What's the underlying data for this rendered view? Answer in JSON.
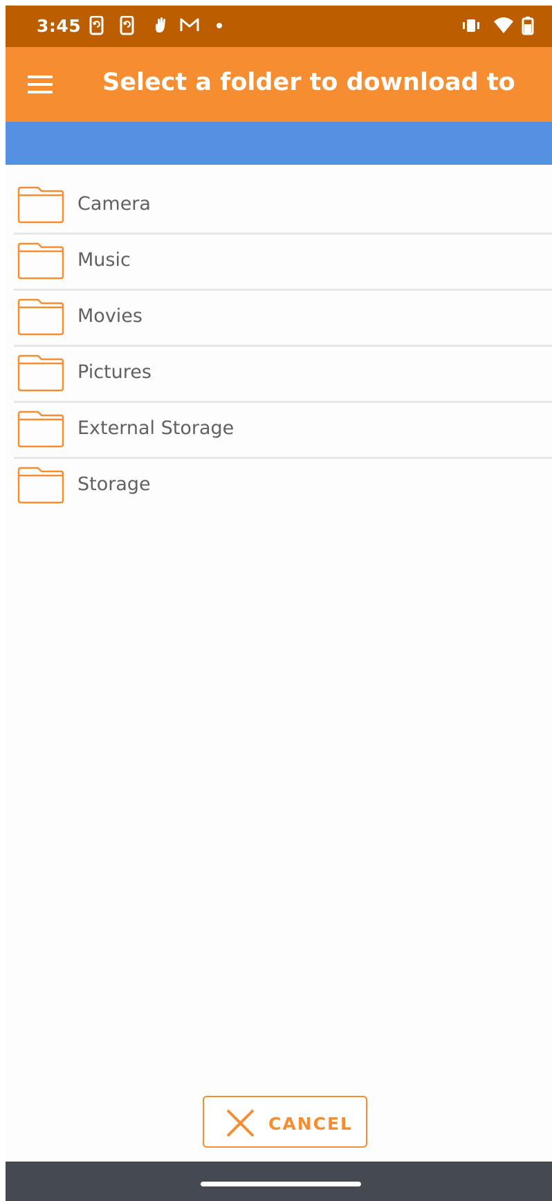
{
  "status_bar": {
    "time": "3:45",
    "left_icons": [
      "phone-sync-icon",
      "phone-sync-icon",
      "hand-wave-icon",
      "gmail-icon",
      "notification-dot-icon"
    ],
    "right_icons": [
      "vibrate-icon",
      "wifi-icon",
      "battery-icon"
    ],
    "background_color": "#bc5e00"
  },
  "app_bar": {
    "title": "Select a folder to download to",
    "menu_icon": "hamburger-menu-icon",
    "background_color": "#f68d31"
  },
  "path_bar": {
    "background_color": "#5690e2"
  },
  "folders": [
    {
      "label": "Camera",
      "icon": "folder-icon"
    },
    {
      "label": "Music",
      "icon": "folder-icon"
    },
    {
      "label": "Movies",
      "icon": "folder-icon"
    },
    {
      "label": "Pictures",
      "icon": "folder-icon"
    },
    {
      "label": "External Storage",
      "icon": "folder-icon"
    },
    {
      "label": "Storage",
      "icon": "folder-icon"
    }
  ],
  "cancel_button": {
    "label": "CANCEL",
    "icon": "close-icon"
  },
  "colors": {
    "accent": "#f68d31",
    "nav_bar": "#444a50"
  }
}
